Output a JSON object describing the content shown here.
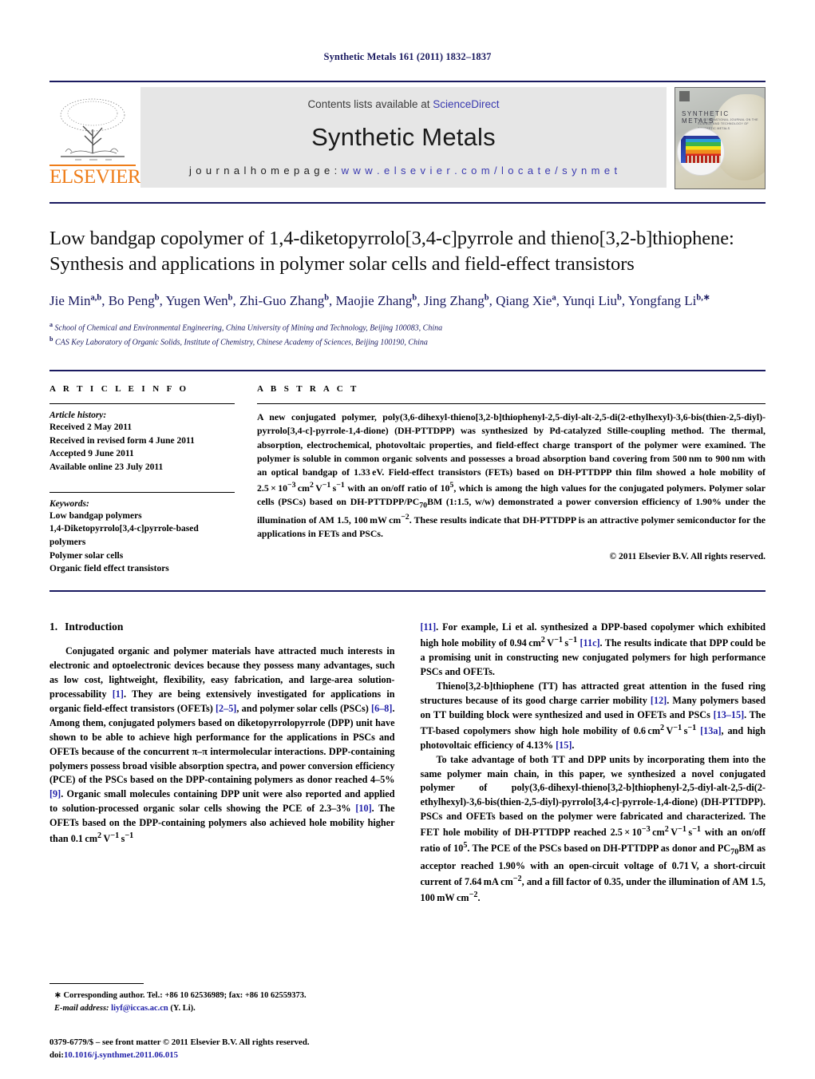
{
  "running_head": "Synthetic Metals 161 (2011) 1832–1837",
  "banner": {
    "publisher": "ELSEVIER",
    "contents_prefix": "Contents lists available at ",
    "contents_link": "ScienceDirect",
    "journal_name": "Synthetic Metals",
    "homepage_prefix": "j o u r n a l   h o m e p a g e :   ",
    "homepage_url": "w w w . e l s e v i e r . c o m / l o c a t e / s y n m e t",
    "cover_title": "SYNTHETIC METALS",
    "cover_subtitle": "AN INTERNATIONAL JOURNAL ON THE SCIENCE AND TECHNOLOGY OF SYNTHETIC METALS",
    "link_color": "#3a3ab0",
    "elsevier_orange": "#ef7d19",
    "rule_navy": "#1a1a60"
  },
  "article": {
    "title": "Low bandgap copolymer of 1,4-diketopyrrolo[3,4-c]pyrrole and thieno[3,2-b]thiophene: Synthesis and applications in polymer solar cells and field-effect transistors",
    "authors_html": "Jie Min<sup>a,b</sup>, Bo Peng<sup>b</sup>, Yugen Wen<sup>b</sup>, Zhi-Guo Zhang<sup>b</sup>, Maojie Zhang<sup>b</sup>, Jing Zhang<sup>b</sup>, Qiang Xie<sup>a</sup>, Yunqi Liu<sup>b</sup>, Yongfang Li<sup>b,</sup><sup>∗</sup>",
    "affiliations": [
      {
        "marker": "a",
        "text": "School of Chemical and Environmental Engineering, China University of Mining and Technology, Beijing 100083, China"
      },
      {
        "marker": "b",
        "text": "CAS Key Laboratory of Organic Solids, Institute of Chemistry, Chinese Academy of Sciences, Beijing 100190, China"
      }
    ]
  },
  "article_info": {
    "heading": "A R T I C L E   I N F O",
    "history_label": "Article history:",
    "history": [
      "Received 2 May 2011",
      "Received in revised form 4 June 2011",
      "Accepted 9 June 2011",
      "Available online 23 July 2011"
    ],
    "keywords_label": "Keywords:",
    "keywords": [
      "Low bandgap polymers",
      "1,4-Diketopyrrolo[3,4-c]pyrrole-based polymers",
      "Polymer solar cells",
      "Organic field effect transistors"
    ]
  },
  "abstract": {
    "heading": "A B S T R A C T",
    "text_html": "A new conjugated polymer, poly(3,6-dihexyl-thieno[3,2-b]thiophenyl-2,5-diyl-alt-2,5-di(2-ethylhexyl)-3,6-bis(thien-2,5-diyl)-pyrrolo[3,4-c]-pyrrole-1,4-dione) (DH-PTTDPP) was synthesized by Pd-catalyzed Stille-coupling method. The thermal, absorption, electrochemical, photovoltaic properties, and field-effect charge transport of the polymer were examined. The polymer is soluble in common organic solvents and possesses a broad absorption band covering from 500&#8239;nm to 900&#8239;nm with an optical bandgap of 1.33&#8239;eV. Field-effect transistors (FETs) based on DH-PTTDPP thin film showed a hole mobility of 2.5&#8239;&#215;&#8239;10<sup>&#8722;3</sup>&#8239;cm<sup>2</sup>&#8239;V<sup>&#8722;1</sup>&#8239;s<sup>&#8722;1</sup> with an on/off ratio of 10<sup>5</sup>, which is among the high values for the conjugated polymers. Polymer solar cells (PSCs) based on DH-PTTDPP/PC<sub>70</sub>BM (1:1.5, w/w) demonstrated a power conversion efficiency of 1.90% under the illumination of AM 1.5, 100&#8239;mW&#8239;cm<sup>&#8722;2</sup>. These results indicate that DH-PTTDPP is an attractive polymer semiconductor for the applications in FETs and PSCs.",
    "copyright": "© 2011 Elsevier B.V. All rights reserved."
  },
  "body": {
    "section_number": "1.",
    "section_title": "Introduction",
    "left_paragraphs_html": [
      "Conjugated organic and polymer materials have attracted much interests in electronic and optoelectronic devices because they possess many advantages, such as low cost, lightweight, flexibility, easy fabrication, and large-area solution-processability <span class=\"cite\">[1]</span>. They are being extensively investigated for applications in organic field-effect transistors (OFETs) <span class=\"cite\">[2–5]</span>, and polymer solar cells (PSCs) <span class=\"cite\">[6–8]</span>. Among them, conjugated polymers based on diketopyrrolopyrrole (DPP) unit have shown to be able to achieve high performance for the applications in PSCs and OFETs because of the concurrent &#960;&#8211;&#960; intermolecular interactions. DPP-containing polymers possess broad visible absorption spectra, and power conversion efficiency (PCE) of the PSCs based on the DPP-containing polymers as donor reached 4–5% <span class=\"cite\">[9]</span>. Organic small molecules containing DPP unit were also reported and applied to solution-processed organic solar cells showing the PCE of 2.3–3% <span class=\"cite\">[10]</span>. The OFETs based on the DPP-containing polymers also achieved hole mobility higher than 0.1&#8239;cm<sup>2</sup>&#8239;V<sup>&#8722;1</sup>&#8239;s<sup>&#8722;1</sup>"
    ],
    "right_paragraphs_html": [
      "<span class=\"cite\">[11]</span>. For example, Li et al. synthesized a DPP-based copolymer which exhibited high hole mobility of 0.94&#8239;cm<sup>2</sup>&#8239;V<sup>&#8722;1</sup>&#8239;s<sup>&#8722;1</sup> <span class=\"cite\">[11c]</span>. The results indicate that DPP could be a promising unit in constructing new conjugated polymers for high performance PSCs and OFETs.",
      "Thieno[3,2-b]thiophene (TT) has attracted great attention in the fused ring structures because of its good charge carrier mobility <span class=\"cite\">[12]</span>. Many polymers based on TT building block were synthesized and used in OFETs and PSCs <span class=\"cite\">[13–15]</span>. The TT-based copolymers show high hole mobility of 0.6&#8239;cm<sup>2</sup>&#8239;V<sup>&#8722;1</sup>&#8239;s<sup>&#8722;1</sup> <span class=\"cite\">[13a]</span>, and high photovoltaic efficiency of 4.13% <span class=\"cite\">[15]</span>.",
      "To take advantage of both TT and DPP units by incorporating them into the same polymer main chain, in this paper, we synthesized a novel conjugated polymer of poly(3,6-dihexyl-thieno[3,2-b]thiophenyl-2,5-diyl-alt-2,5-di(2-ethylhexyl)-3,6-bis(thien-2,5-diyl)-pyrrolo[3,4-c]-pyrrole-1,4-dione) (DH-PTTDPP). PSCs and OFETs based on the polymer were fabricated and characterized. The FET hole mobility of DH-PTTDPP reached 2.5&#8239;&#215;&#8239;10<sup>&#8722;3</sup>&#8239;cm<sup>2</sup>&#8239;V<sup>&#8722;1</sup>&#8239;s<sup>&#8722;1</sup> with an on/off ratio of 10<sup>5</sup>. The PCE of the PSCs based on DH-PTTDPP as donor and PC<sub>70</sub>BM as acceptor reached 1.90% with an open-circuit voltage of 0.71&#8239;V, a short-circuit current of 7.64&#8239;mA&#8239;cm<sup>&#8722;2</sup>, and a fill factor of 0.35, under the illumination of AM 1.5, 100&#8239;mW&#8239;cm<sup>&#8722;2</sup>."
    ]
  },
  "footnotes": {
    "corresponding_html": "<span style=\"font-weight:bold\">∗</span> Corresponding author. Tel.: +86 10 62536989; fax: +86 10 62559373.",
    "email_label": "E-mail address:",
    "email": "liyf@iccas.ac.cn",
    "email_suffix": "(Y. Li).",
    "issn_line": "0379-6779/$ – see front matter © 2011 Elsevier B.V. All rights reserved.",
    "doi_label": "doi:",
    "doi": "10.1016/j.synthmet.2011.06.015"
  }
}
